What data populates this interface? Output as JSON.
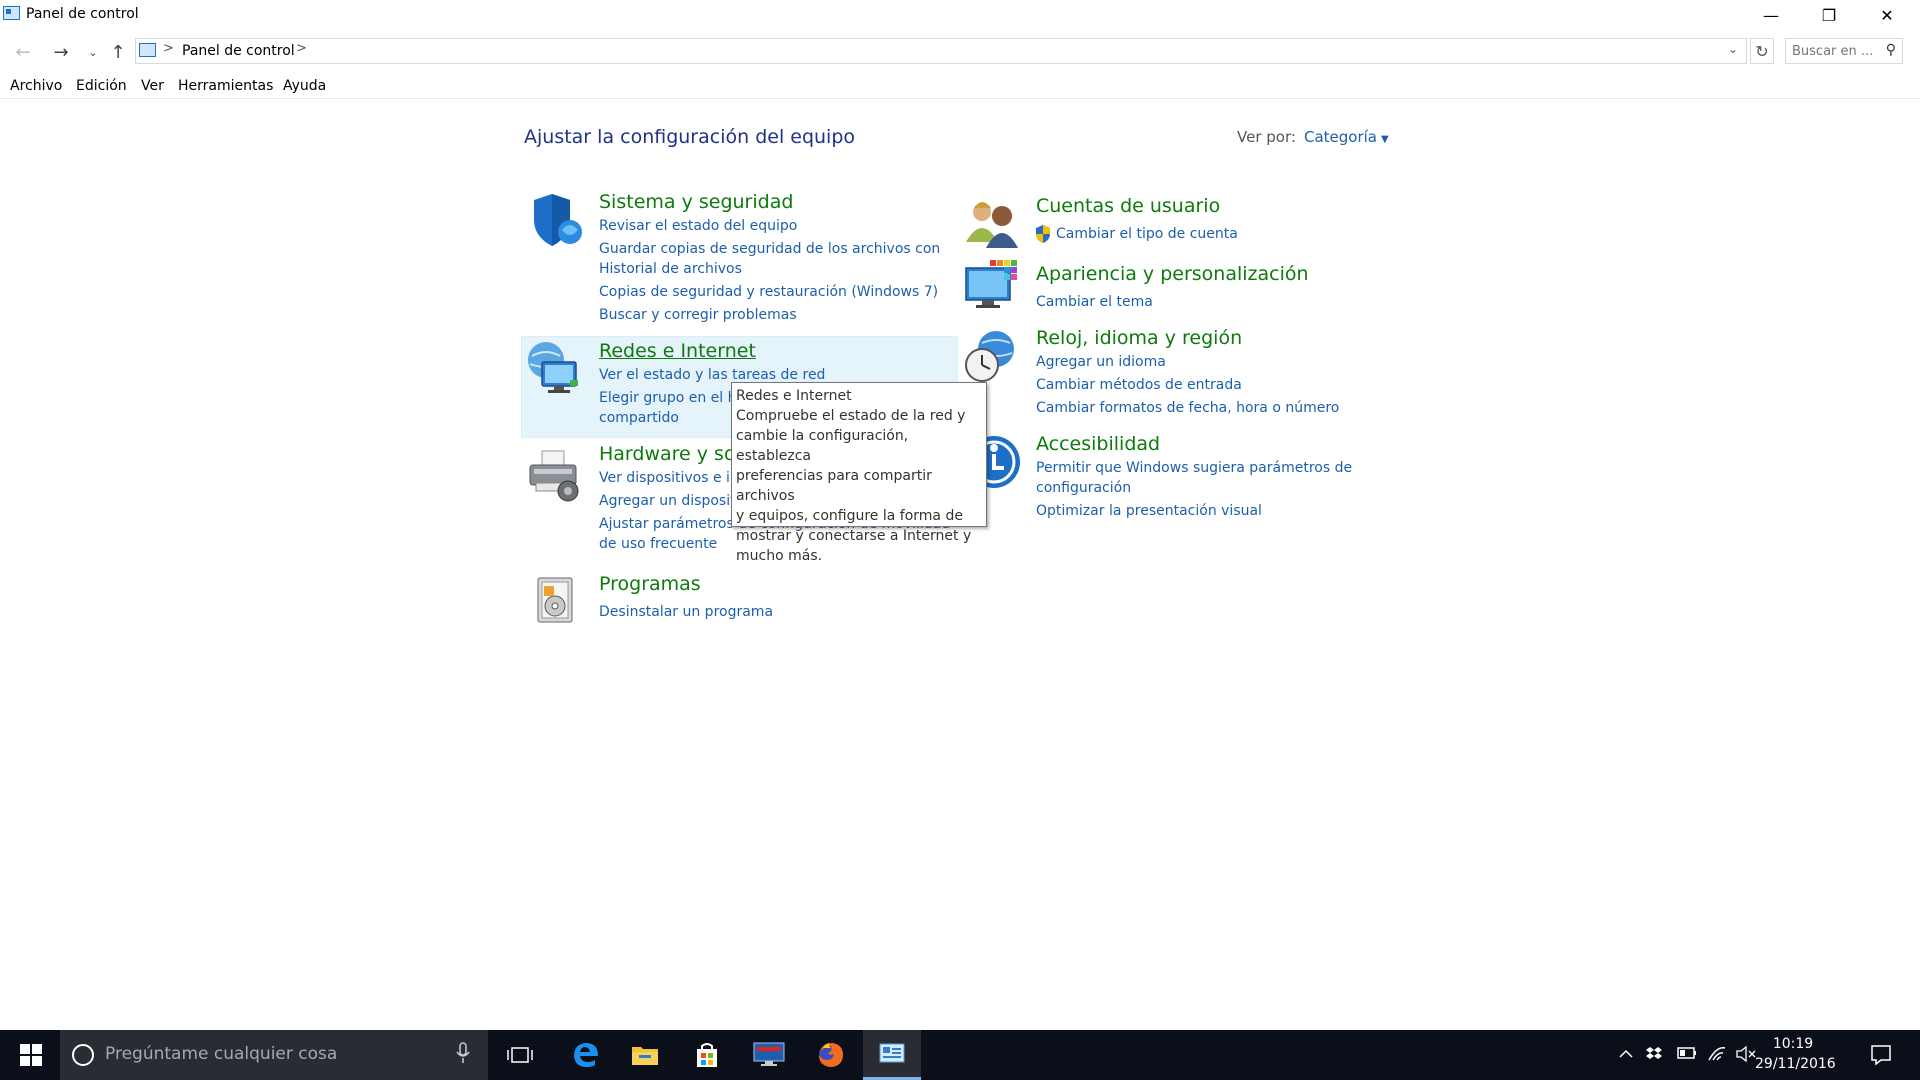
{
  "window": {
    "title": "Panel de control",
    "minimize_glyph": "—",
    "restore_glyph": "❐",
    "close_glyph": "✕"
  },
  "address_bar": {
    "crumb": "Panel de control",
    "separator": ">",
    "search_placeholder": "Buscar en ..."
  },
  "menu": [
    "Archivo",
    "Edición",
    "Ver",
    "Herramientas",
    "Ayuda"
  ],
  "content": {
    "heading": "Ajustar la configuración del equipo",
    "view_by_label": "Ver por:",
    "view_by_value": "Categoría"
  },
  "categories": {
    "system": {
      "title": "Sistema y seguridad",
      "links": [
        "Revisar el estado del equipo",
        "Guardar copias de seguridad de los archivos con",
        "Historial de archivos",
        "Copias de seguridad y restauración (Windows 7)",
        "Buscar y corregir problemas"
      ]
    },
    "network": {
      "title": "Redes e Internet",
      "links": [
        "Ver el estado y las tareas de red",
        "Elegir grupo en el hogar y opciones de uso",
        "compartido"
      ]
    },
    "hardware": {
      "title": "Hardware y sonido",
      "links": [
        "Ver dispositivos e impresoras",
        "Agregar un dispositivo",
        "Ajustar parámetros de configuración de movilidad",
        "de uso frecuente"
      ]
    },
    "programs": {
      "title": "Programas",
      "links": [
        "Desinstalar un programa"
      ]
    },
    "users": {
      "title": "Cuentas de usuario",
      "links": [
        "Cambiar el tipo de cuenta"
      ]
    },
    "appearance": {
      "title": "Apariencia y personalización",
      "links": [
        "Cambiar el tema"
      ]
    },
    "clock": {
      "title": "Reloj, idioma y región",
      "links": [
        "Agregar un idioma",
        "Cambiar métodos de entrada",
        "Cambiar formatos de fecha, hora o número"
      ]
    },
    "access": {
      "title": "Accesibilidad",
      "links": [
        "Permitir que Windows sugiera parámetros de",
        "configuración",
        "Optimizar la presentación visual"
      ]
    }
  },
  "tooltip": {
    "title": "Redes e Internet",
    "lines": [
      "Compruebe el estado de la red y",
      "cambie la configuración, establezca",
      "preferencias para compartir archivos",
      "y equipos, configure la forma de",
      "mostrar y conectarse a Internet y",
      "mucho más."
    ]
  },
  "taskbar": {
    "search_placeholder": "Pregúntame cualquier cosa",
    "time": "10:19",
    "date": "29/11/2016"
  },
  "icons": [
    "control-panel-icon",
    "back-arrow-icon",
    "forward-arrow-icon",
    "recent-dropdown-icon",
    "up-arrow-icon",
    "refresh-icon",
    "search-icon",
    "shield-icon",
    "network-icon",
    "printer-icon",
    "programs-icon",
    "users-icon",
    "uac-shield-icon",
    "appearance-icon",
    "clock-globe-icon",
    "accessibility-icon",
    "windows-start-icon",
    "cortana-icon",
    "microphone-icon",
    "task-view-icon",
    "edge-icon",
    "file-explorer-icon",
    "store-icon",
    "lenovo-icon",
    "firefox-icon",
    "chevron-up-icon",
    "dropbox-icon",
    "battery-icon",
    "wifi-icon",
    "volume-muted-icon",
    "notifications-icon"
  ],
  "colors": {
    "category_title": "#0e7a0d",
    "link": "#1c5fad",
    "heading": "#1e3287",
    "hover_highlight": "#e5f3fb",
    "taskbar": "#0b0f19"
  }
}
